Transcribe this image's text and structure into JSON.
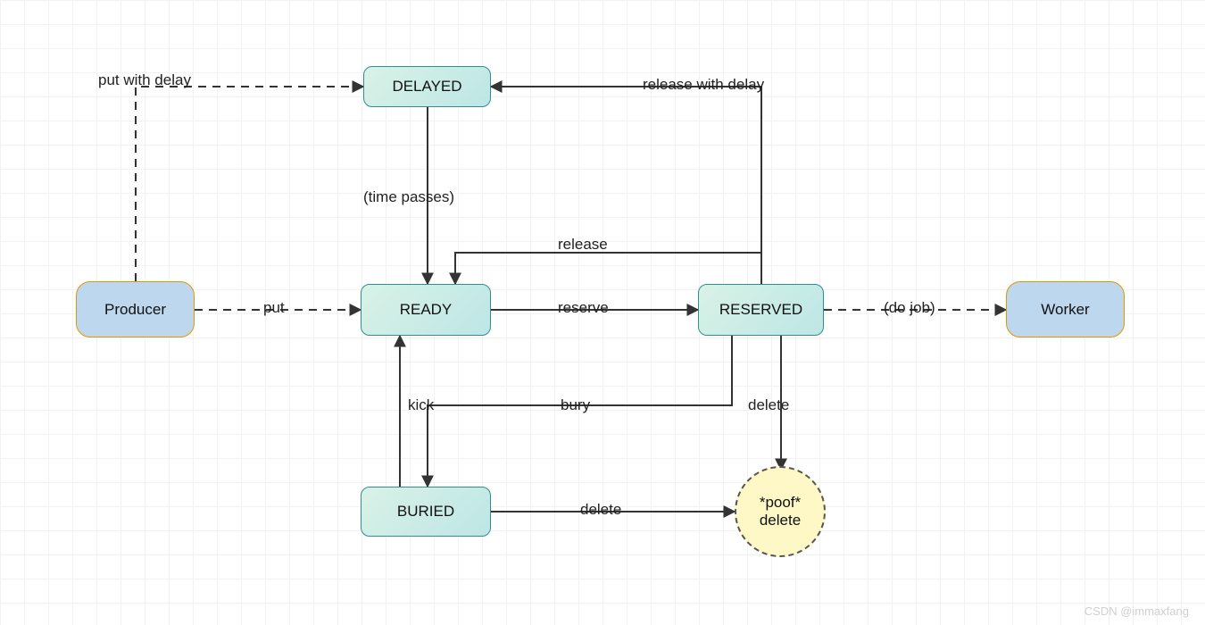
{
  "nodes": {
    "producer": {
      "label": "Producer"
    },
    "worker": {
      "label": "Worker"
    },
    "delayed": {
      "label": "DELAYED"
    },
    "ready": {
      "label": "READY"
    },
    "reserved": {
      "label": "RESERVED"
    },
    "buried": {
      "label": "BURIED"
    },
    "poof": {
      "label": "*poof*\ndelete"
    }
  },
  "edges": {
    "put_delay": "put with delay",
    "put": "put",
    "time_passes": "(time passes)",
    "release": "release",
    "reserve": "reserve",
    "release_delay": "release with delay",
    "do_job": "(do job)",
    "kick": "kick",
    "bury": "bury",
    "delete1": "delete",
    "delete2": "delete"
  },
  "watermark": "CSDN @immaxfang"
}
